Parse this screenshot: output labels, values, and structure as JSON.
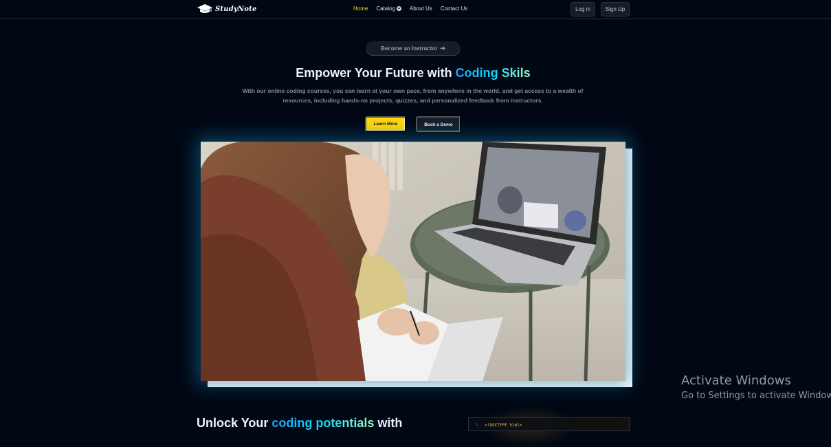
{
  "brand": {
    "name": "StudyNote",
    "icon": "graduation-cap-icon"
  },
  "nav": {
    "items": [
      {
        "label": "Home",
        "active": true
      },
      {
        "label": "Catalog",
        "active": false
      },
      {
        "label": "About Us",
        "active": false
      },
      {
        "label": "Contact Us",
        "active": false
      }
    ],
    "login_label": "Log in",
    "signup_label": "Sign Up"
  },
  "hero": {
    "instructor_label": "Become an Instructor",
    "title_prefix": "Empower Your Future with",
    "title_highlight": "Coding Skils",
    "subtitle": "With our online coding courses, you can learn at your own pace, from anywhere in the world, and get access to a wealth of resources, including hands-on projects, quizzes, and personalized feedback from instructors.",
    "primary_label": "Learn More",
    "secondary_label": "Book a Demo"
  },
  "section2": {
    "title_prefix": "Unlock Your",
    "title_highlight": "coding potentials",
    "title_suffix": "with",
    "code_line_number": "1",
    "code_line": "<!DOCTYPE html>"
  },
  "watermark": {
    "title": "Activate Windows",
    "subtitle": "Go to Settings to activate Windows."
  },
  "colors": {
    "background": "#000814",
    "accent_yellow": "#ffd60a",
    "highlight_blue": "#12d8fa"
  }
}
